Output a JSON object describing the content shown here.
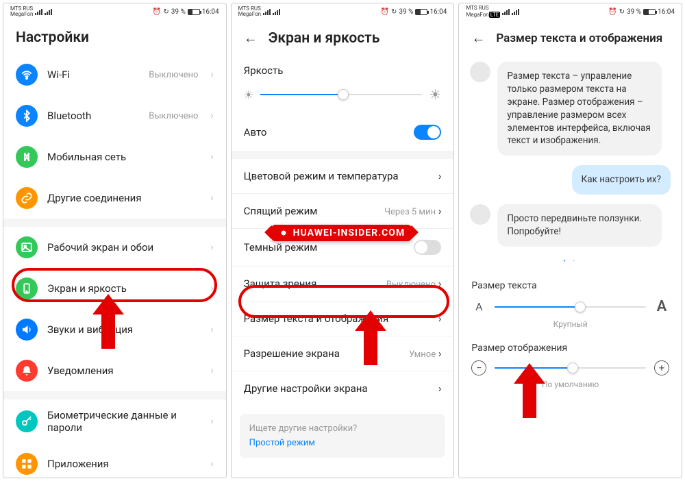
{
  "status": {
    "carrier1": "MTS RUS",
    "carrier2": "MegaFon",
    "battery_text": "39 %",
    "time": "16:04",
    "alarm": "⏰"
  },
  "watermark": "HUAWEI-INSIDER.COM",
  "phone1": {
    "title": "Настройки",
    "items": [
      {
        "label": "Wi-Fi",
        "value": "Выключено",
        "color": "c-blue",
        "icon": "wifi"
      },
      {
        "label": "Bluetooth",
        "value": "Выключено",
        "color": "c-blue",
        "icon": "bt"
      },
      {
        "label": "Мобильная сеть",
        "value": "",
        "color": "c-green",
        "icon": "mobile"
      },
      {
        "label": "Другие соединения",
        "value": "",
        "color": "c-orange",
        "icon": "link"
      },
      {
        "label": "Рабочий экран и обои",
        "value": "",
        "color": "c-green",
        "icon": "home"
      },
      {
        "label": "Экран и яркость",
        "value": "",
        "color": "c-green",
        "icon": "display"
      },
      {
        "label": "Звуки и вибрация",
        "value": "",
        "color": "c-darkblue",
        "icon": "sound"
      },
      {
        "label": "Уведомления",
        "value": "",
        "color": "c-red",
        "icon": "bell"
      },
      {
        "label": "Биометрические данные и пароли",
        "value": "",
        "color": "c-teal",
        "icon": "lock"
      },
      {
        "label": "Приложения",
        "value": "",
        "color": "c-orange",
        "icon": "apps"
      }
    ]
  },
  "phone2": {
    "title": "Экран и яркость",
    "brightness_label": "Яркость",
    "brightness_value": 50,
    "auto_label": "Авто",
    "auto_on": true,
    "rows": [
      {
        "label": "Цветовой режим и температура",
        "value": ""
      },
      {
        "label": "Спящий режим",
        "value": "Через 5 мин"
      },
      {
        "label": "Темный режим",
        "value": "",
        "toggle_off": true
      },
      {
        "label": "Защита зрения",
        "value": "Выключено"
      },
      {
        "label": "Размер текста и отображения",
        "value": ""
      },
      {
        "label": "Разрешение экрана",
        "value": "Умное"
      },
      {
        "label": "Другие настройки экрана",
        "value": ""
      }
    ],
    "footer_q": "Ищете другие настройки?",
    "footer_link": "Простой режим"
  },
  "phone3": {
    "title": "Размер текста и отображения",
    "msg1": "Размер текста – управление только размером текста на экране. Размер отображения – управление размером всех элементов интерфейса, включая текст и изображения.",
    "msg2": "Как настроить их?",
    "msg3": "Просто передвиньте ползунки. Попробуйте!",
    "text_size_label": "Размер текста",
    "text_size_caption": "Крупный",
    "text_size_value": 55,
    "display_size_label": "Размер отображения",
    "display_size_caption": "По умолчанию",
    "display_size_value": 50
  }
}
